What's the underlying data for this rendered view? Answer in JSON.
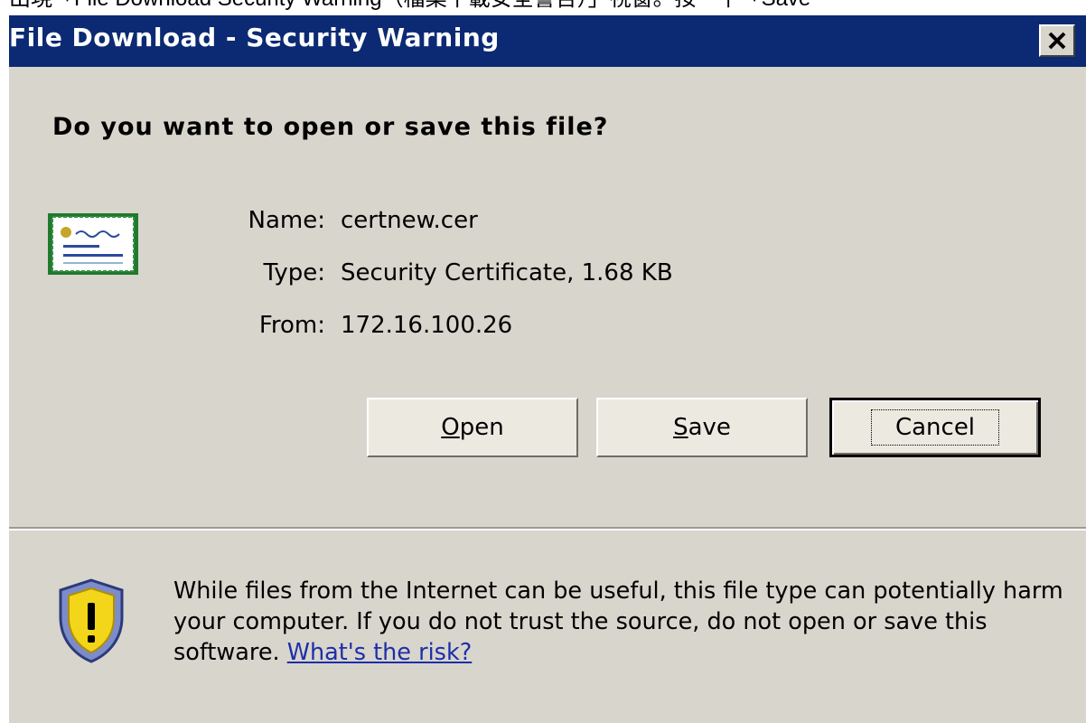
{
  "caption": {
    "text": "出現「File Download Security Warning（檔案下載安全警告）」視窗。按一下「Save"
  },
  "window": {
    "title": "File Download - Security Warning",
    "close_label": "✕"
  },
  "dialog": {
    "question": "Do you want to open or save this file?",
    "file": {
      "name_label": "Name:",
      "name_value": "certnew.cer",
      "type_label": "Type:",
      "type_value": "Security Certificate, 1.68 KB",
      "from_label": "From:",
      "from_value": "172.16.100.26"
    },
    "buttons": {
      "open_mnemonic": "O",
      "open_rest": "pen",
      "save_mnemonic": "S",
      "save_rest": "ave",
      "cancel_label": "Cancel"
    },
    "warning": {
      "text": "While files from the Internet can be useful, this file type can potentially harm your computer. If you do not trust the source, do not open or save this software.",
      "link": "What's the risk?"
    }
  },
  "icons": {
    "certificate": "certificate-icon",
    "shield": "shield-warning-icon",
    "close": "close-icon"
  },
  "colors": {
    "titlebar": "#0b2a73",
    "dialog_bg": "#d8d5cd",
    "link": "#1d2fa8"
  }
}
